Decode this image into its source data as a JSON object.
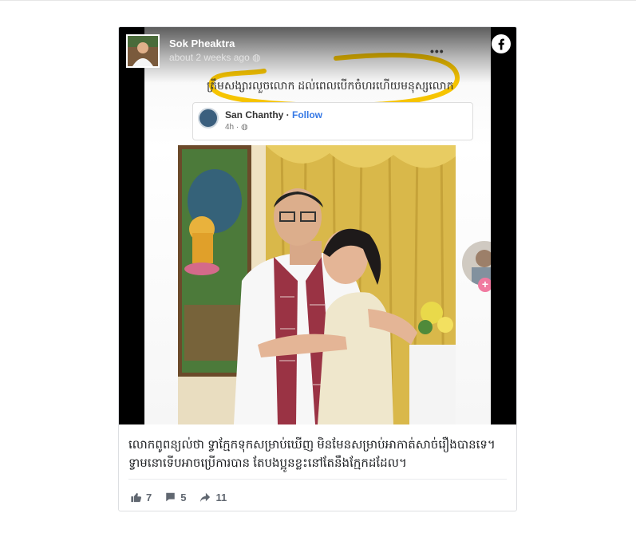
{
  "post": {
    "author": "Sok Pheaktra",
    "time": "about 2 weeks ago",
    "caption": "លោកពូពន្យល់ថា ទ្វាក្មែកទុកសម្រាប់ឃើញ មិនមែនសម្រាប់អាកាត់សាច់រឿងបានទេ។ ទ្វាមនោទើបអាចប្រើការបាន តែបងប្អូនខ្លះនៅតែនឹងក្មែកដដែល។",
    "reactions": {
      "likes": "7",
      "comments": "5",
      "shares": "11"
    }
  },
  "screenshot": {
    "quote": "ត្រឹមសង្សារលួចលោក ដល់ពេលបើកចំហរហើយមនុស្សលោក",
    "embed_name": "San Chanthy",
    "embed_sep": " · ",
    "embed_follow": "Follow",
    "embed_time": "4h · "
  },
  "colors": {
    "highlight": "#f6c400",
    "follow": "#3578e5",
    "scarf_red": "#9a3344",
    "curtain": "#d9b84a"
  },
  "icons": {
    "brand": "facebook-icon",
    "like": "thumbs-up-icon",
    "comment": "comment-icon",
    "share": "share-icon",
    "privacy": "globe-icon",
    "more": "more-icon"
  }
}
